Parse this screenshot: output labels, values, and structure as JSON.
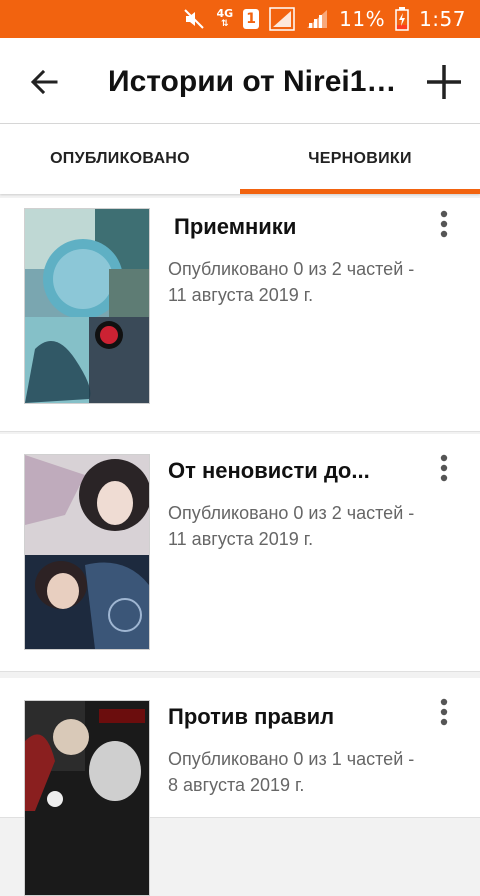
{
  "status_bar": {
    "network": "4G",
    "sim": "1",
    "battery_pct": "11%",
    "time": "1:57"
  },
  "app_bar": {
    "title": "Истории от Nirei12...",
    "icons": [
      "arrow-back-icon",
      "plus-icon"
    ]
  },
  "tabs": [
    {
      "label": "ОПУБЛИКОВАНО",
      "active": false
    },
    {
      "label": "ЧЕРНОВИКИ",
      "active": true
    }
  ],
  "stories": [
    {
      "title": "Приемники",
      "meta_line1": "Опубликовано 0 из 2 частей -",
      "meta_line2": "11 августа 2019 г."
    },
    {
      "title": "От неновисти до...",
      "meta_line1": "Опубликовано 0 из 2 частей -",
      "meta_line2": "11 августа 2019 г."
    },
    {
      "title": "Против правил",
      "meta_line1": "Опубликовано 0 из 1 частей -",
      "meta_line2": "8 августа 2019 г."
    }
  ],
  "colors": {
    "accent": "#f2630f",
    "meta_text": "#666666"
  }
}
